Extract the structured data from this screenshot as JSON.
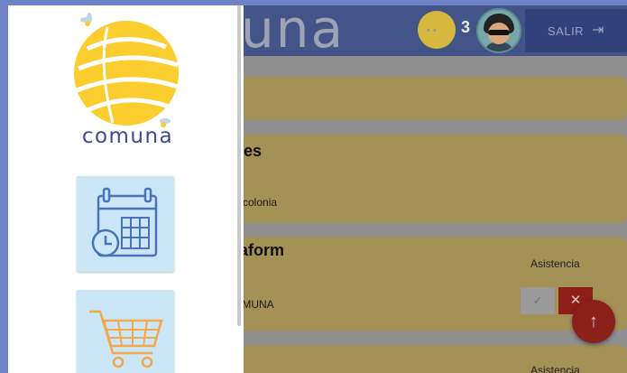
{
  "drawer": {
    "logo_text": "comuna",
    "items": [
      {
        "icon": "calendar-clock-icon"
      },
      {
        "icon": "shopping-cart-icon"
      }
    ]
  },
  "topbar": {
    "brand_partial": "una",
    "coins": "3",
    "logout_label": "SALIR",
    "logout_icon": "⇥"
  },
  "cards": [
    {
      "title": "",
      "subtitle": ""
    },
    {
      "title": "ues",
      "subtitle": "a colonia"
    },
    {
      "title": "taform",
      "subtitle": "OMUNA",
      "attendance_label": "Asistencia",
      "confirm_icon": "✓",
      "decline_icon": "✕"
    },
    {
      "title": "",
      "attendance_label": "Asistencia"
    }
  ],
  "fab": {
    "icon": "↑"
  },
  "colors": {
    "brand_blue": "#3c4b8d",
    "logo_yellow": "#fccd2f",
    "tile_bg": "#cae6f7",
    "calendar_blue": "#4b74b8",
    "cart_orange": "#f4a84d",
    "decline_red": "#c0312a"
  }
}
